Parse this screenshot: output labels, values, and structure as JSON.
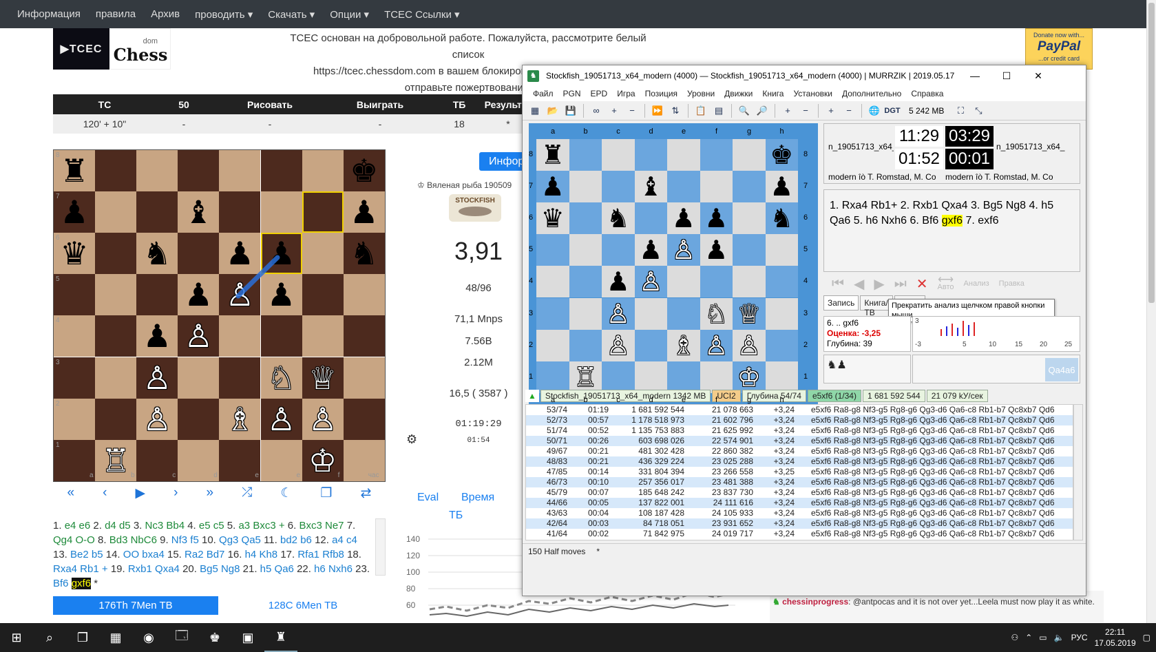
{
  "nav": {
    "items": [
      "Информация",
      "правила",
      "Архив",
      "проводить ▾",
      "Скачать ▾",
      "Опции ▾",
      "TCEC Ссылки ▾"
    ]
  },
  "banner": {
    "tcec_logo": "▶TCEC",
    "chessdom_logo": "Chess",
    "chessdom_small": "dom",
    "line1": "TCEC основан на добровольной работе. Пожалуйста, рассмотрите белый список",
    "line2": "https://tcec.chessdom.com в вашем блокировщике рекламы - или отправьте пожертвование.",
    "paypal_top": "Donate now with...",
    "paypal_brand": "PayPal",
    "paypal_bottom": "...or credit card"
  },
  "info_table": {
    "headers": [
      "TC",
      "50",
      "Рисовать",
      "Выиграть",
      "ТБ",
      "Результат"
    ],
    "values": [
      "120' + 10\"",
      "-",
      "-",
      "-",
      "18",
      "*"
    ]
  },
  "web_board": {
    "ranks": [
      "8",
      "7",
      "6",
      "5",
      "4",
      "3",
      "2",
      "1"
    ],
    "files": [
      "a",
      "b",
      "c",
      "d",
      "e",
      "e",
      "f",
      "час"
    ],
    "pieces": [
      [
        "♜",
        "",
        "",
        "",
        "",
        "",
        "",
        "♚"
      ],
      [
        "♟",
        "",
        "",
        "♝",
        "",
        "",
        "",
        "♟"
      ],
      [
        "♛",
        "",
        "♞",
        "",
        "♟",
        "♟",
        "",
        "♞"
      ],
      [
        "",
        "",
        "",
        "♟",
        "♙",
        "♟",
        "",
        ""
      ],
      [
        "",
        "",
        "♟",
        "♙",
        "",
        "",
        "",
        ""
      ],
      [
        "",
        "",
        "♙",
        "",
        "",
        "♘",
        "♕",
        ""
      ],
      [
        "",
        "",
        "♙",
        "",
        "♗",
        "♙",
        "♙",
        ""
      ],
      [
        "",
        "♖",
        "",
        "",
        "",
        "",
        "♔",
        ""
      ]
    ]
  },
  "board_controls": [
    "«",
    "‹",
    "▶",
    "›",
    "»",
    "⤮",
    "☾",
    "❐",
    "⇄"
  ],
  "moves": [
    {
      "n": "1.",
      "m": "e4 e6"
    },
    {
      "n": "2.",
      "m": "d4 d5"
    },
    {
      "n": "3.",
      "m": "Nc3 Bb4"
    },
    {
      "n": "4.",
      "m": "e5 c5"
    },
    {
      "n": "5.",
      "m": "a3 Bxc3 +"
    },
    {
      "n": "6.",
      "m": "Bxc3 Ne7"
    },
    {
      "n": "7.",
      "m": "Qg4 O-O"
    },
    {
      "n": "8.",
      "m": "Bd3 NbC6"
    },
    {
      "n": "9.",
      "m": "Nf3 f5"
    },
    {
      "n": "10.",
      "m": "Qg3 Qa5"
    },
    {
      "n": "11.",
      "m": "bd2 b6"
    },
    {
      "n": "12.",
      "m": "a4 c4"
    },
    {
      "n": "13.",
      "m": "Be2 b5"
    },
    {
      "n": "14.",
      "m": "OO bxa4"
    },
    {
      "n": "15.",
      "m": "Ra2 Bd7"
    },
    {
      "n": "16.",
      "m": "h4 Kh8"
    },
    {
      "n": "17.",
      "m": "Rfa1 Rfb8"
    },
    {
      "n": "18.",
      "m": "Rxa4 Rb1 +"
    },
    {
      "n": "19.",
      "m": "Rxb1 Qxa4"
    },
    {
      "n": "20.",
      "m": "Bg5 Ng8"
    },
    {
      "n": "21.",
      "m": "h5 Qa6"
    },
    {
      "n": "22.",
      "m": "h6 Nxh6"
    },
    {
      "n": "23.",
      "m": "Bf6"
    }
  ],
  "current_move": "gxf6",
  "moves_end": "*",
  "tb_tabs": {
    "tb1": "176Th 7Men TB",
    "tb2": "128C 6Men TB"
  },
  "middle": {
    "info_button": "Инфор",
    "engine_name": "♔ Вяленая рыба 190509",
    "logo_text": "STOCKFISH",
    "eval": "3,91",
    "depth": "48/96",
    "speed": "71,1 Mnps",
    "nodes": "7.56B",
    "tb_hits": "2.12M",
    "hash": "16,5 ( 3587 )",
    "time_used": "01:19:29",
    "time_left": "01:54",
    "tabs": {
      "eval": "Eval",
      "time": "Время",
      "tb": "ТБ"
    },
    "chart_ticks": [
      "140",
      "120",
      "100",
      "80",
      "60"
    ]
  },
  "chat": {
    "user": "chessinprogress",
    "text": ": @antpocas and it is not over yet...Leela must now play it as white."
  },
  "app": {
    "title": "Stockfish_19051713_x64_modern (4000)  —  Stockfish_19051713_x64_modern (4000)   |   MURRZIK   |   2019.05.17",
    "menu": [
      "Файл",
      "PGN",
      "EPD",
      "Игра",
      "Позиция",
      "Уровни",
      "Движки",
      "Книга",
      "Установки",
      "Дополнительно",
      "Справка"
    ],
    "memory": "5 242 MB",
    "board": {
      "files": [
        "a",
        "b",
        "c",
        "d",
        "e",
        "f",
        "g",
        "h"
      ],
      "ranks": [
        "8",
        "7",
        "6",
        "5",
        "4",
        "3",
        "2",
        "1"
      ],
      "pieces": [
        [
          "♜",
          "",
          "",
          "",
          "",
          "",
          "",
          "♚"
        ],
        [
          "♟",
          "",
          "",
          "♝",
          "",
          "",
          "",
          "♟"
        ],
        [
          "♛",
          "",
          "♞",
          "",
          "♟",
          "♟",
          "",
          "♞"
        ],
        [
          "",
          "",
          "",
          "♟",
          "♙",
          "♟",
          "",
          ""
        ],
        [
          "",
          "",
          "♟",
          "♙",
          "",
          "",
          "",
          ""
        ],
        [
          "",
          "",
          "♙",
          "",
          "",
          "♘",
          "♕",
          ""
        ],
        [
          "",
          "",
          "♙",
          "",
          "♗",
          "♙",
          "♙",
          ""
        ],
        [
          "",
          "♖",
          "",
          "",
          "",
          "",
          "♔",
          ""
        ]
      ]
    },
    "clocks": {
      "white_time": "11:29",
      "white_move": "01:52",
      "black_time": "03:29",
      "black_move": "00:01"
    },
    "player_left_top": "n_19051713_x64_",
    "player_right_top": "n_19051713_x64_",
    "player_left_bottom": "modern îò T. Romstad, M. Co",
    "player_right_bottom": "modern îò T. Romstad, M. Co",
    "notation": "1. Rxa4 Rb1+ 2. Rxb1 Qxa4 3. Bg5 Ng8 4. h5 Qa6 5. h6 Nxh6 6. Bf6",
    "notation_current": "gxf6",
    "notation_tail": "7. exf6",
    "nav_auto": "Авто",
    "nav_analysis": "Анализ",
    "nav_edit": "Правка",
    "tabs": [
      "Запись",
      "Книга/ТВ",
      "Запис"
    ],
    "tooltip": "Прекратить анализ щелчком правой кнопки мыши",
    "analysis_move": "6. .. gxf6",
    "analysis_eval": "Оценка: -3,25",
    "analysis_depth": "Глубина: 39",
    "minichart_ticks": [
      "-3",
      "5",
      "10",
      "15",
      "20",
      "25"
    ],
    "minichart_top": "3",
    "material": "♞♟",
    "qa4": "Qa4a6",
    "engine_header": [
      "Stockfish_19051713_x64_modern  1342 MB",
      "UCI2",
      "Глубина 54/74",
      "e5xf6 (1/34)",
      "1 681 592 544",
      "21 079 kУ/сек"
    ],
    "engine_lines": [
      [
        "53/74",
        "01:19",
        "1 681 592 544",
        "21 078 663",
        "+3,24"
      ],
      [
        "52/73",
        "00:57",
        "1 178 518 973",
        "21 602 796",
        "+3,24"
      ],
      [
        "51/74",
        "00:52",
        "1 135 753 883",
        "21 625 992",
        "+3,24"
      ],
      [
        "50/71",
        "00:26",
        "603 698 026",
        "22 574 901",
        "+3,24"
      ],
      [
        "49/67",
        "00:21",
        "481 302 428",
        "22 860 382",
        "+3,24"
      ],
      [
        "48/83",
        "00:21",
        "436 329 224",
        "23 025 288",
        "+3,24"
      ],
      [
        "47/85",
        "00:14",
        "331 804 394",
        "23 266 558",
        "+3,25"
      ],
      [
        "46/73",
        "00:10",
        "257 356 017",
        "23 481 388",
        "+3,24"
      ],
      [
        "45/79",
        "00:07",
        "185 648 242",
        "23 837 730",
        "+3,24"
      ],
      [
        "44/66",
        "00:05",
        "137 822 001",
        "24 111 616",
        "+3,24"
      ],
      [
        "43/63",
        "00:04",
        "108 187 428",
        "24 105 933",
        "+3,24"
      ],
      [
        "42/64",
        "00:03",
        "84 718 051",
        "23 931 652",
        "+3,24"
      ],
      [
        "41/64",
        "00:02",
        "71 842 975",
        "24 019 717",
        "+3,24"
      ]
    ],
    "pv": "e5xf6 Ra8-g8 Nf3-g5 Rg8-g6 Qg3-d6 Qa6-c8 Rb1-b7 Qc8xb7 Qd6",
    "status_moves": "150 Half moves",
    "status_star": "*"
  },
  "taskbar": {
    "lang": "РУС",
    "time": "22:11",
    "date": "17.05.2019"
  }
}
